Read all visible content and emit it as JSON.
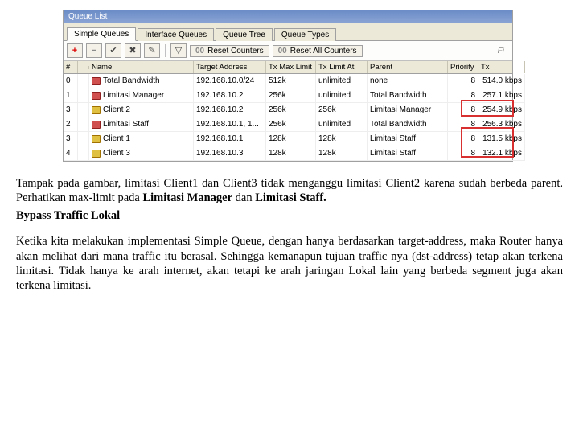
{
  "window": {
    "title": "Queue List",
    "tabs": [
      "Simple Queues",
      "Interface Queues",
      "Queue Tree",
      "Queue Types"
    ],
    "toolbar": {
      "reset_counters": "Reset Counters",
      "reset_all": "Reset All Counters",
      "find_placeholder": "Fi"
    },
    "columns": [
      "#",
      "",
      "Name",
      "Target Address",
      "Tx Max Limit",
      "Tx Limit At",
      "Parent",
      "Priority",
      "Tx"
    ],
    "rows": [
      {
        "num": "0",
        "indent": 0,
        "icon": "red",
        "name": "Total Bandwidth",
        "target": "192.168.10.0/24",
        "txmax": "512k",
        "txlim": "unlimited",
        "parent": "none",
        "prio": "8",
        "tx": "514.0 kbps"
      },
      {
        "num": "1",
        "indent": 1,
        "icon": "red",
        "name": "Limitasi Manager",
        "target": "192.168.10.2",
        "txmax": "256k",
        "txlim": "unlimited",
        "parent": "Total Bandwidth",
        "prio": "8",
        "tx": "257.1 kbps"
      },
      {
        "num": "3",
        "indent": 2,
        "icon": "yel",
        "name": "Client 2",
        "target": "192.168.10.2",
        "txmax": "256k",
        "txlim": "256k",
        "parent": "Limitasi Manager",
        "prio": "8",
        "tx": "254.9 kbps"
      },
      {
        "num": "2",
        "indent": 1,
        "icon": "red",
        "name": "Limitasi Staff",
        "target": "192.168.10.1, 1...",
        "txmax": "256k",
        "txlim": "unlimited",
        "parent": "Total Bandwidth",
        "prio": "8",
        "tx": "256.3 kbps"
      },
      {
        "num": "3",
        "indent": 2,
        "icon": "yel",
        "name": "Client 1",
        "target": "192.168.10.1",
        "txmax": "128k",
        "txlim": "128k",
        "parent": "Limitasi Staff",
        "prio": "8",
        "tx": "131.5 kbps"
      },
      {
        "num": "4",
        "indent": 2,
        "icon": "yel",
        "name": "Client 3",
        "target": "192.168.10.3",
        "txmax": "128k",
        "txlim": "128k",
        "parent": "Limitasi Staff",
        "prio": "8",
        "tx": "132.1 kbps"
      }
    ]
  },
  "text": {
    "p1a": "Tampak pada gambar, limitasi Client1 dan Client3 tidak menganggu limitasi Client2 karena sudah berbeda parent. Perhatikan max-limit pada ",
    "p1b": "Limitasi Manager",
    "p1c": " dan ",
    "p1d": "Limitasi Staff.",
    "p2": "Bypass Traffic Lokal",
    "p3": "Ketika kita melakukan implementasi Simple Queue, dengan hanya berdasarkan target-address, maka Router hanya akan melihat dari mana traffic itu berasal. Sehingga kemanapun tujuan traffic nya (dst-address) tetap akan terkena limitasi. Tidak hanya ke arah internet, akan tetapi ke arah jaringan Lokal lain yang berbeda segment juga akan terkena limitasi."
  }
}
